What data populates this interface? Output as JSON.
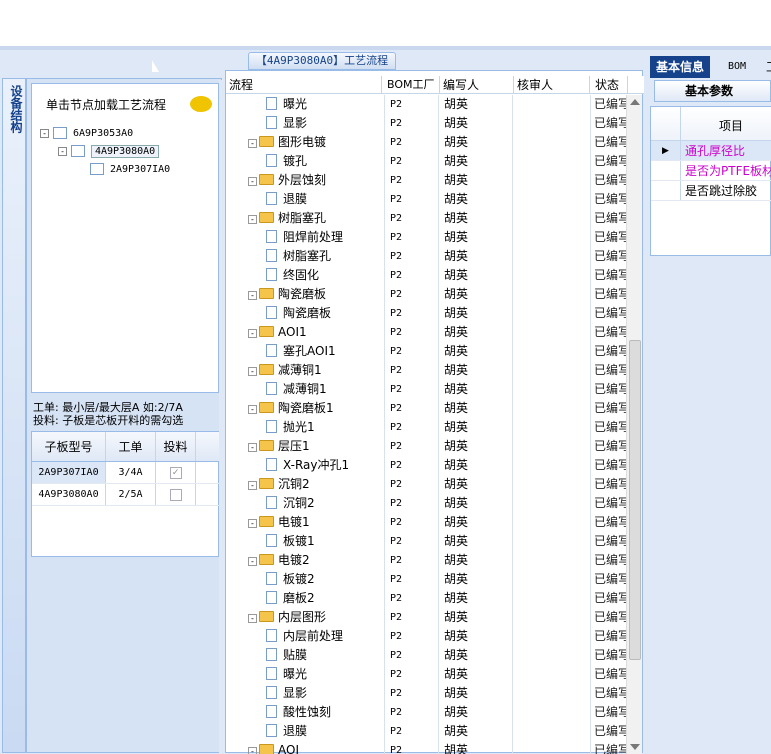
{
  "left_tab": {
    "label": "设备结构"
  },
  "tree_panel": {
    "hint": "单击节点加载工艺流程",
    "nodes": [
      {
        "label": "6A9P3053A0",
        "expander": "-"
      },
      {
        "label": "4A9P3080A0",
        "expander": "-"
      },
      {
        "label": "2A9P307IA0",
        "expander": ""
      }
    ]
  },
  "note": {
    "line1": "工单: 最小层/最大层A 如:2/7A",
    "line2": "投料: 子板是芯板开料的需勾选"
  },
  "sub_grid": {
    "headers": [
      "子板型号",
      "工单",
      "投料"
    ],
    "rows": [
      {
        "model": "2A9P307IA0",
        "order": "3/4A",
        "feed": "✓"
      },
      {
        "model": "4A9P3080A0",
        "order": "2/5A",
        "feed": ""
      }
    ]
  },
  "center": {
    "title": "【4A9P3080A0】工艺流程",
    "headers": [
      "流程",
      "BOM工厂",
      "编写人",
      "核审人",
      "状态"
    ],
    "rows": [
      {
        "name": "曝光",
        "kind": "doc",
        "plant": "P2",
        "writer": "胡英",
        "status": "已编写"
      },
      {
        "name": "显影",
        "kind": "doc",
        "plant": "P2",
        "writer": "胡英",
        "status": "已编写"
      },
      {
        "name": "图形电镀",
        "kind": "folder",
        "plant": "P2",
        "writer": "胡英",
        "status": "已编写"
      },
      {
        "name": "镀孔",
        "kind": "doc",
        "plant": "P2",
        "writer": "胡英",
        "status": "已编写"
      },
      {
        "name": "外层蚀刻",
        "kind": "folder",
        "plant": "P2",
        "writer": "胡英",
        "status": "已编写"
      },
      {
        "name": "退膜",
        "kind": "doc",
        "plant": "P2",
        "writer": "胡英",
        "status": "已编写"
      },
      {
        "name": "树脂塞孔",
        "kind": "folder",
        "plant": "P2",
        "writer": "胡英",
        "status": "已编写"
      },
      {
        "name": "阻焊前处理",
        "kind": "doc",
        "plant": "P2",
        "writer": "胡英",
        "status": "已编写"
      },
      {
        "name": "树脂塞孔",
        "kind": "doc",
        "plant": "P2",
        "writer": "胡英",
        "status": "已编写"
      },
      {
        "name": "终固化",
        "kind": "doc",
        "plant": "P2",
        "writer": "胡英",
        "status": "已编写"
      },
      {
        "name": "陶瓷磨板",
        "kind": "folder",
        "plant": "P2",
        "writer": "胡英",
        "status": "已编写"
      },
      {
        "name": "陶瓷磨板",
        "kind": "doc",
        "plant": "P2",
        "writer": "胡英",
        "status": "已编写"
      },
      {
        "name": "AOI1",
        "kind": "folder",
        "plant": "P2",
        "writer": "胡英",
        "status": "已编写"
      },
      {
        "name": "塞孔AOI1",
        "kind": "doc",
        "plant": "P2",
        "writer": "胡英",
        "status": "已编写"
      },
      {
        "name": "减薄铜1",
        "kind": "folder",
        "plant": "P2",
        "writer": "胡英",
        "status": "已编写"
      },
      {
        "name": "减薄铜1",
        "kind": "doc",
        "plant": "P2",
        "writer": "胡英",
        "status": "已编写"
      },
      {
        "name": "陶瓷磨板1",
        "kind": "folder",
        "plant": "P2",
        "writer": "胡英",
        "status": "已编写"
      },
      {
        "name": "抛光1",
        "kind": "doc",
        "plant": "P2",
        "writer": "胡英",
        "status": "已编写"
      },
      {
        "name": "层压1",
        "kind": "folder",
        "plant": "P2",
        "writer": "胡英",
        "status": "已编写"
      },
      {
        "name": "X-Ray冲孔1",
        "kind": "doc",
        "plant": "P2",
        "writer": "胡英",
        "status": "已编写"
      },
      {
        "name": "沉铜2",
        "kind": "folder",
        "plant": "P2",
        "writer": "胡英",
        "status": "已编写"
      },
      {
        "name": "沉铜2",
        "kind": "doc",
        "plant": "P2",
        "writer": "胡英",
        "status": "已编写"
      },
      {
        "name": "电镀1",
        "kind": "folder",
        "plant": "P2",
        "writer": "胡英",
        "status": "已编写"
      },
      {
        "name": "板镀1",
        "kind": "doc",
        "plant": "P2",
        "writer": "胡英",
        "status": "已编写"
      },
      {
        "name": "电镀2",
        "kind": "folder",
        "plant": "P2",
        "writer": "胡英",
        "status": "已编写"
      },
      {
        "name": "板镀2",
        "kind": "doc",
        "plant": "P2",
        "writer": "胡英",
        "status": "已编写"
      },
      {
        "name": "磨板2",
        "kind": "doc",
        "plant": "P2",
        "writer": "胡英",
        "status": "已编写"
      },
      {
        "name": "内层图形",
        "kind": "folder",
        "plant": "P2",
        "writer": "胡英",
        "status": "已编写"
      },
      {
        "name": "内层前处理",
        "kind": "doc",
        "plant": "P2",
        "writer": "胡英",
        "status": "已编写"
      },
      {
        "name": "贴膜",
        "kind": "doc",
        "plant": "P2",
        "writer": "胡英",
        "status": "已编写"
      },
      {
        "name": "曝光",
        "kind": "doc",
        "plant": "P2",
        "writer": "胡英",
        "status": "已编写"
      },
      {
        "name": "显影",
        "kind": "doc",
        "plant": "P2",
        "writer": "胡英",
        "status": "已编写"
      },
      {
        "name": "酸性蚀刻",
        "kind": "doc",
        "plant": "P2",
        "writer": "胡英",
        "status": "已编写"
      },
      {
        "name": "退膜",
        "kind": "doc",
        "plant": "P2",
        "writer": "胡英",
        "status": "已编写"
      },
      {
        "name": "AOI",
        "kind": "folder",
        "plant": "P2",
        "writer": "胡英",
        "status": "已编写"
      }
    ]
  },
  "right": {
    "tabs": [
      "基本信息",
      "BOM",
      "工"
    ],
    "subtab": "基本参数",
    "header": "项目",
    "rows": [
      {
        "label": "通孔厚径比",
        "color": "#cc00cc",
        "selected": true
      },
      {
        "label": "是否为PTFE板材",
        "color": "#cc00cc",
        "selected": false
      },
      {
        "label": "是否跳过除胶",
        "color": "#000000",
        "selected": false
      }
    ]
  }
}
